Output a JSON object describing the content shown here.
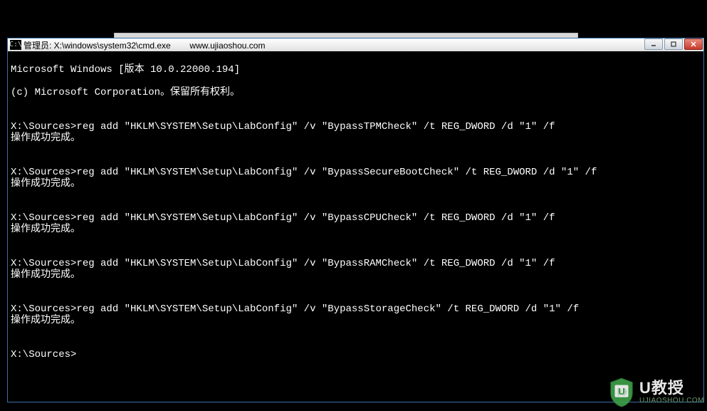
{
  "window": {
    "icon_label": "C:\\",
    "title": "管理员: X:\\windows\\system32\\cmd.exe        www.ujiaoshou.com"
  },
  "console": {
    "header1": "Microsoft Windows [版本 10.0.22000.194]",
    "header2": "(c) Microsoft Corporation。保留所有权利。",
    "success_msg": "操作成功完成。",
    "prompt": "X:\\Sources>",
    "commands": [
      "reg add \"HKLM\\SYSTEM\\Setup\\LabConfig\" /v \"BypassTPMCheck\" /t REG_DWORD /d \"1\" /f",
      "reg add \"HKLM\\SYSTEM\\Setup\\LabConfig\" /v \"BypassSecureBootCheck\" /t REG_DWORD /d \"1\" /f",
      "reg add \"HKLM\\SYSTEM\\Setup\\LabConfig\" /v \"BypassCPUCheck\" /t REG_DWORD /d \"1\" /f",
      "reg add \"HKLM\\SYSTEM\\Setup\\LabConfig\" /v \"BypassRAMCheck\" /t REG_DWORD /d \"1\" /f",
      "reg add \"HKLM\\SYSTEM\\Setup\\LabConfig\" /v \"BypassStorageCheck\" /t REG_DWORD /d \"1\" /f"
    ]
  },
  "watermark": {
    "big": "U教授",
    "small": "UJIAOSHOU.COM"
  }
}
